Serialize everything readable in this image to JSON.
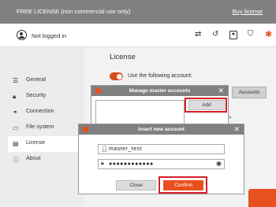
{
  "banner": {
    "license_text": "FREE LICENSE (non commercial use only)",
    "buy_label": "Buy license"
  },
  "header": {
    "login_status": "Not logged in",
    "icons": [
      "swap-icon",
      "history-icon",
      "user-card-icon",
      "shield-icon",
      "gear-icon"
    ]
  },
  "sidebar": {
    "items": [
      {
        "label": "General",
        "icon": "sliders-icon"
      },
      {
        "label": "Security",
        "icon": "lock-icon"
      },
      {
        "label": "Connection",
        "icon": "link-icon"
      },
      {
        "label": "File system",
        "icon": "folder-icon"
      },
      {
        "label": "License",
        "icon": "license-icon"
      },
      {
        "label": "About",
        "icon": "info-icon"
      }
    ],
    "active_index": 4
  },
  "main": {
    "title": "License",
    "toggle_label": "Use the following account:",
    "accounts_button": "Accounts",
    "partial_text": "nt>"
  },
  "manage_dialog": {
    "title": "Manage master accounts",
    "add_label": "Add"
  },
  "insert_dialog": {
    "title": "Insert new account",
    "username_value": "master_test",
    "password_value": "●●●●●●●●●●●●",
    "close_label": "Close",
    "confirm_label": "Confirm"
  },
  "colors": {
    "accent": "#e8501e",
    "highlight": "#d61f26",
    "titlebar": "#808080"
  }
}
